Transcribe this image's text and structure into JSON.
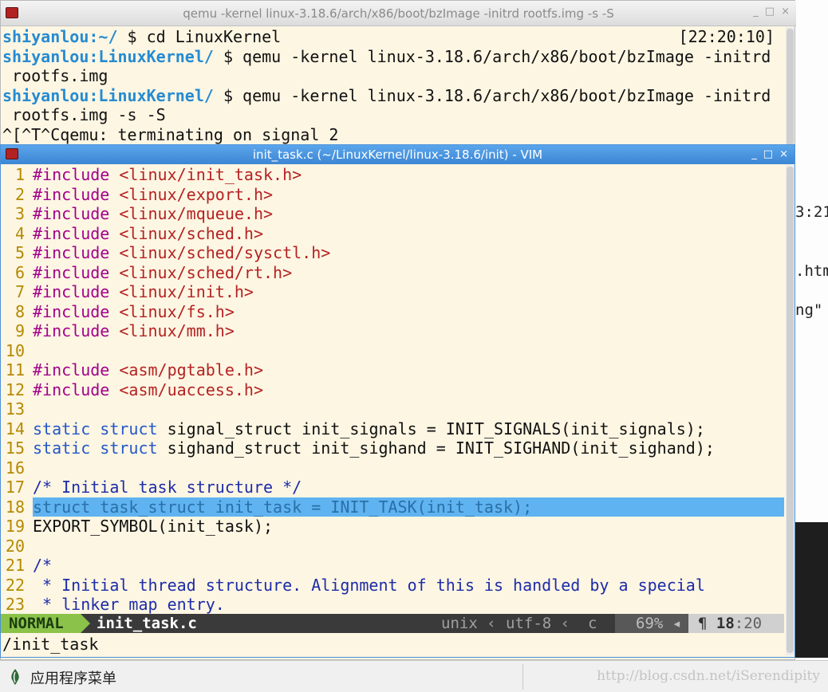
{
  "terminal": {
    "title": "qemu -kernel linux-3.18.6/arch/x86/boot/bzImage -initrd rootfs.img -s -S",
    "window_buttons": [
      "_",
      "□",
      "×"
    ],
    "lines": [
      {
        "user": "shiyanlou",
        "path": ":~/",
        "cmd": " $ cd LinuxKernel",
        "timestamp": "[22:20:10]"
      },
      {
        "user": "shiyanlou",
        "path": ":LinuxKernel/",
        "cmd": " $ qemu -kernel linux-3.18.6/arch/x86/boot/bzImage -initrd"
      },
      {
        "text": " rootfs.img"
      },
      {
        "user": "shiyanlou",
        "path": ":LinuxKernel/",
        "cmd": " $ qemu -kernel linux-3.18.6/arch/x86/boot/bzImage -initrd"
      },
      {
        "text": " rootfs.img -s -S"
      },
      {
        "text": "^[^T^Cqemu: terminating on signal 2"
      }
    ]
  },
  "background_fragments": [
    "3:21",
    ".htm",
    "ng\""
  ],
  "vim": {
    "title": "init_task.c (~/LinuxKernel/linux-3.18.6/init) - VIM",
    "window_buttons": [
      "_",
      "□",
      "×"
    ],
    "lines": [
      {
        "n": "1",
        "tokens": [
          {
            "t": "#include ",
            "c": "pp"
          },
          {
            "t": "<linux/init_task.h>",
            "c": "inc"
          }
        ]
      },
      {
        "n": "2",
        "tokens": [
          {
            "t": "#include ",
            "c": "pp"
          },
          {
            "t": "<linux/export.h>",
            "c": "inc"
          }
        ]
      },
      {
        "n": "3",
        "tokens": [
          {
            "t": "#include ",
            "c": "pp"
          },
          {
            "t": "<linux/mqueue.h>",
            "c": "inc"
          }
        ]
      },
      {
        "n": "4",
        "tokens": [
          {
            "t": "#include ",
            "c": "pp"
          },
          {
            "t": "<linux/sched.h>",
            "c": "inc"
          }
        ]
      },
      {
        "n": "5",
        "tokens": [
          {
            "t": "#include ",
            "c": "pp"
          },
          {
            "t": "<linux/sched/sysctl.h>",
            "c": "inc"
          }
        ]
      },
      {
        "n": "6",
        "tokens": [
          {
            "t": "#include ",
            "c": "pp"
          },
          {
            "t": "<linux/sched/rt.h>",
            "c": "inc"
          }
        ]
      },
      {
        "n": "7",
        "tokens": [
          {
            "t": "#include ",
            "c": "pp"
          },
          {
            "t": "<linux/init.h>",
            "c": "inc"
          }
        ]
      },
      {
        "n": "8",
        "tokens": [
          {
            "t": "#include ",
            "c": "pp"
          },
          {
            "t": "<linux/fs.h>",
            "c": "inc"
          }
        ]
      },
      {
        "n": "9",
        "tokens": [
          {
            "t": "#include ",
            "c": "pp"
          },
          {
            "t": "<linux/mm.h>",
            "c": "inc"
          }
        ]
      },
      {
        "n": "10",
        "tokens": []
      },
      {
        "n": "11",
        "tokens": [
          {
            "t": "#include ",
            "c": "pp"
          },
          {
            "t": "<asm/pgtable.h>",
            "c": "inc"
          }
        ]
      },
      {
        "n": "12",
        "tokens": [
          {
            "t": "#include ",
            "c": "pp"
          },
          {
            "t": "<asm/uaccess.h>",
            "c": "inc"
          }
        ]
      },
      {
        "n": "13",
        "tokens": []
      },
      {
        "n": "14",
        "tokens": [
          {
            "t": "static ",
            "c": "kw"
          },
          {
            "t": "struct ",
            "c": "kw"
          },
          {
            "t": "signal_struct init_signals = INIT_SIGNALS(init_signals);",
            "c": "plain"
          }
        ]
      },
      {
        "n": "15",
        "tokens": [
          {
            "t": "static ",
            "c": "kw"
          },
          {
            "t": "struct ",
            "c": "kw"
          },
          {
            "t": "sighand_struct init_sighand = INIT_SIGHAND(init_sighand);",
            "c": "plain"
          }
        ]
      },
      {
        "n": "16",
        "tokens": []
      },
      {
        "n": "17",
        "tokens": [
          {
            "t": "/* Initial task structure */",
            "c": "cm"
          }
        ]
      },
      {
        "n": "18",
        "highlight": true,
        "tokens": [
          {
            "t": "struct task_struct init_task = INIT_TASK(init_task);",
            "c": "hl"
          }
        ]
      },
      {
        "n": "19",
        "tokens": [
          {
            "t": "EXPORT_SYMBOL(init_task);",
            "c": "plain"
          }
        ]
      },
      {
        "n": "20",
        "tokens": []
      },
      {
        "n": "21",
        "tokens": [
          {
            "t": "/*",
            "c": "cm"
          }
        ]
      },
      {
        "n": "22",
        "tokens": [
          {
            "t": " * Initial thread structure. Alignment of this is handled by a special",
            "c": "cm"
          }
        ]
      },
      {
        "n": "23",
        "tokens": [
          {
            "t": " * linker map entry.",
            "c": "cm"
          }
        ]
      }
    ],
    "status": {
      "mode": "NORMAL",
      "file": "init_task.c",
      "fileformat": "unix",
      "encoding": "utf-8",
      "filetype": "c",
      "percent": "69%",
      "line": "18",
      "col": ":20"
    },
    "cmdline": "/init_task"
  },
  "taskbar": {
    "menu_label": "应用程序菜单"
  },
  "watermark": "http://blog.csdn.net/iSerendipity"
}
